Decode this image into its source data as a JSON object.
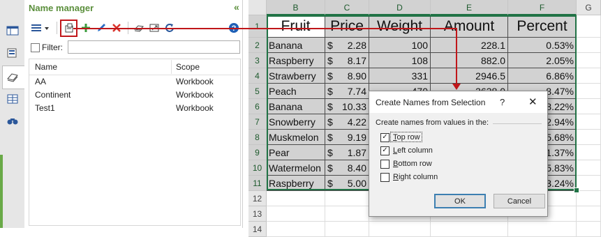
{
  "name_manager": {
    "title": "Name manager",
    "collapse_glyph": "«",
    "filter_label": "Filter:",
    "filter_value": "",
    "columns": [
      "Name",
      "Scope"
    ],
    "rows": [
      {
        "name": "AA",
        "scope": "Workbook"
      },
      {
        "name": "Continent",
        "scope": "Workbook"
      },
      {
        "name": "Test1",
        "scope": "Workbook"
      }
    ],
    "toolbar_icons": [
      "list-view-icon",
      "create-from-selection-icon",
      "add-icon",
      "edit-icon",
      "delete-icon",
      "copy-names-icon",
      "refresh-icon",
      "help-icon"
    ]
  },
  "sheet": {
    "column_letters": [
      "B",
      "C",
      "D",
      "E",
      "F",
      "G"
    ],
    "row_numbers": [
      "1",
      "2",
      "3",
      "4",
      "5",
      "6",
      "7",
      "8",
      "9",
      "10",
      "11",
      "12",
      "13",
      "14"
    ],
    "headers": [
      "Fruit",
      "Price",
      "Weight",
      "Amount",
      "Percent"
    ],
    "rows": [
      {
        "fruit": "Banana",
        "currency": "$",
        "price": "2.28",
        "weight": "100",
        "amount": "228.1",
        "percent": "0.53%"
      },
      {
        "fruit": "Raspberry",
        "currency": "$",
        "price": "8.17",
        "weight": "108",
        "amount": "882.0",
        "percent": "2.05%"
      },
      {
        "fruit": "Strawberry",
        "currency": "$",
        "price": "8.90",
        "weight": "331",
        "amount": "2946.5",
        "percent": "6.86%"
      },
      {
        "fruit": "Peach",
        "currency": "$",
        "price": "7.74",
        "weight": "470",
        "amount": "3638.0",
        "percent": "8.47%"
      },
      {
        "fruit": "Banana",
        "currency": "$",
        "price": "10.33",
        "weight": "",
        "amount": "",
        "percent": "8.22%"
      },
      {
        "fruit": "Snowberry",
        "currency": "$",
        "price": "4.22",
        "weight": "",
        "amount": "",
        "percent": "2.94%"
      },
      {
        "fruit": "Muskmelon",
        "currency": "$",
        "price": "9.19",
        "weight": "",
        "amount": "",
        "percent": "5.68%"
      },
      {
        "fruit": "Pear",
        "currency": "$",
        "price": "1.87",
        "weight": "",
        "amount": "",
        "percent": "1.37%"
      },
      {
        "fruit": "Watermelon",
        "currency": "$",
        "price": "8.40",
        "weight": "",
        "amount": "",
        "percent": "5.83%"
      },
      {
        "fruit": "Raspberry",
        "currency": "$",
        "price": "5.00",
        "weight": "",
        "amount": "",
        "percent": "3.24%"
      }
    ]
  },
  "dialog": {
    "title": "Create Names from Selection",
    "help": "?",
    "close": "✕",
    "prompt": "Create names from values in the:",
    "options": [
      {
        "label": "Top row",
        "checked": true
      },
      {
        "label": "Left column",
        "checked": true
      },
      {
        "label": "Bottom row",
        "checked": false
      },
      {
        "label": "Right column",
        "checked": false
      }
    ],
    "ok_label": "OK",
    "cancel_label": "Cancel"
  },
  "colors": {
    "accent_green": "#5b8f3c",
    "selection_green": "#217346",
    "highlight_red": "#c0161a",
    "selected_cell_gray": "#d2d2d2"
  }
}
